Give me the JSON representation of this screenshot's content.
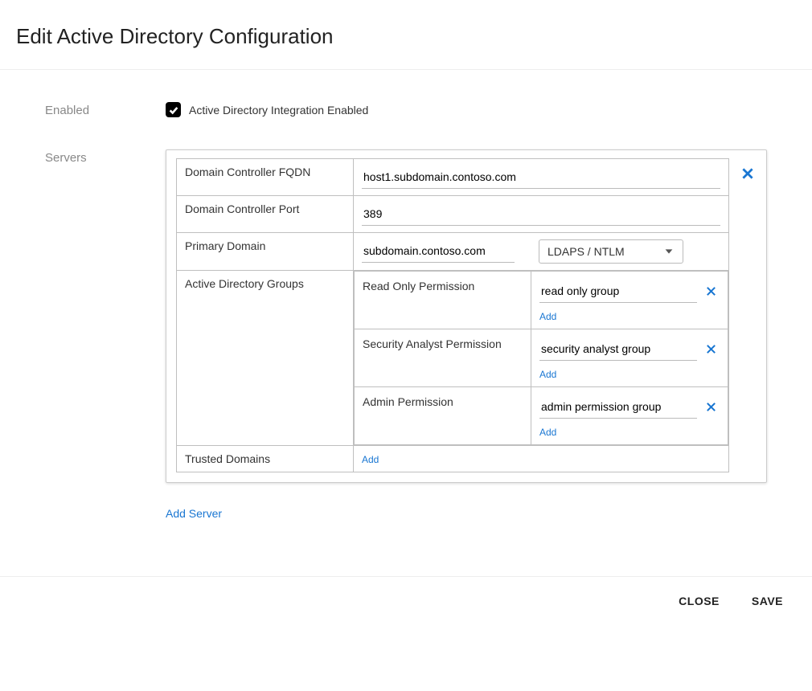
{
  "header": {
    "title": "Edit Active Directory Configuration"
  },
  "form": {
    "enabled_label": "Enabled",
    "enabled_checkbox_text": "Active Directory Integration Enabled",
    "servers_label": "Servers",
    "add_server_label": "Add Server"
  },
  "server": {
    "fqdn_label": "Domain Controller FQDN",
    "fqdn_value": "host1.subdomain.contoso.com",
    "port_label": "Domain Controller Port",
    "port_value": "389",
    "primary_domain_label": "Primary Domain",
    "primary_domain_value": "subdomain.contoso.com",
    "auth_mode_value": "LDAPS / NTLM",
    "groups_label": "Active Directory Groups",
    "trusted_domains_label": "Trusted Domains",
    "add_link": "Add",
    "groups": [
      {
        "perm_label": "Read Only Permission",
        "value": "read only group"
      },
      {
        "perm_label": "Security Analyst Permission",
        "value": "security analyst group"
      },
      {
        "perm_label": "Admin Permission",
        "value": "admin permission group"
      }
    ]
  },
  "footer": {
    "close_label": "CLOSE",
    "save_label": "SAVE"
  }
}
